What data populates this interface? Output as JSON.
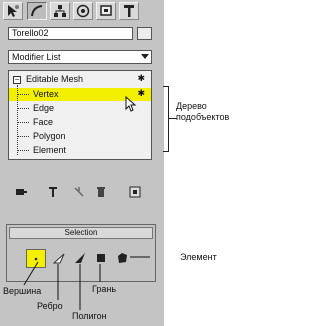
{
  "tabs": [
    {
      "name": "create-tab",
      "icon": "cursor-star-icon"
    },
    {
      "name": "modify-tab",
      "icon": "bend-curve-icon"
    },
    {
      "name": "hierarchy-tab",
      "icon": "hierarchy-icon"
    },
    {
      "name": "motion-tab",
      "icon": "motion-wheel-icon"
    },
    {
      "name": "display-tab",
      "icon": "display-monitor-icon"
    },
    {
      "name": "utilities-tab",
      "icon": "hammer-icon"
    }
  ],
  "object_name": "Torello02",
  "modifier_list": "Modifier List",
  "stack": {
    "root": "Editable Mesh",
    "items": [
      "Vertex",
      "Edge",
      "Face",
      "Polygon",
      "Element"
    ],
    "selected": "Vertex",
    "highlight_color": "#f2f000"
  },
  "selection_rollout": {
    "title": "Selection",
    "buttons": [
      "vertex-icon",
      "edge-icon",
      "face-icon",
      "polygon-icon",
      "element-icon"
    ]
  },
  "callouts": {
    "subobject_tree": "Дерево подобъектов",
    "element": "Элемент",
    "vertex": "Вершина",
    "edge": "Ребро",
    "polygon": "Полигон",
    "face": "Грань"
  }
}
